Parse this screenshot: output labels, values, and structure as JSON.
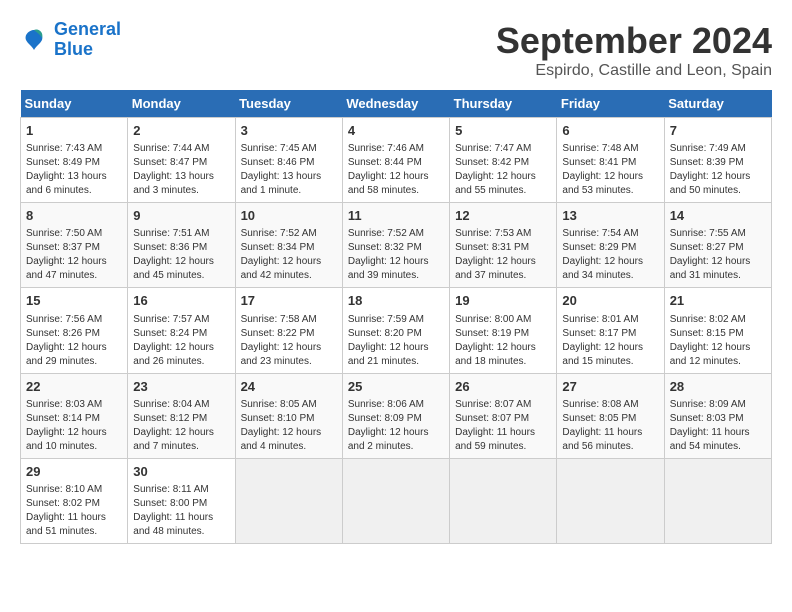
{
  "header": {
    "logo_line1": "General",
    "logo_line2": "Blue",
    "main_title": "September 2024",
    "subtitle": "Espirdo, Castille and Leon, Spain"
  },
  "calendar": {
    "days_of_week": [
      "Sunday",
      "Monday",
      "Tuesday",
      "Wednesday",
      "Thursday",
      "Friday",
      "Saturday"
    ],
    "weeks": [
      [
        {
          "day": "",
          "empty": true
        },
        {
          "day": "",
          "empty": true
        },
        {
          "day": "",
          "empty": true
        },
        {
          "day": "",
          "empty": true
        },
        {
          "day": "",
          "empty": true
        },
        {
          "day": "",
          "empty": true
        },
        {
          "day": "",
          "empty": true
        }
      ],
      [
        {
          "day": "1",
          "sunrise": "7:43 AM",
          "sunset": "8:49 PM",
          "daylight": "13 hours and 6 minutes."
        },
        {
          "day": "2",
          "sunrise": "7:44 AM",
          "sunset": "8:47 PM",
          "daylight": "13 hours and 3 minutes."
        },
        {
          "day": "3",
          "sunrise": "7:45 AM",
          "sunset": "8:46 PM",
          "daylight": "13 hours and 1 minute."
        },
        {
          "day": "4",
          "sunrise": "7:46 AM",
          "sunset": "8:44 PM",
          "daylight": "12 hours and 58 minutes."
        },
        {
          "day": "5",
          "sunrise": "7:47 AM",
          "sunset": "8:42 PM",
          "daylight": "12 hours and 55 minutes."
        },
        {
          "day": "6",
          "sunrise": "7:48 AM",
          "sunset": "8:41 PM",
          "daylight": "12 hours and 53 minutes."
        },
        {
          "day": "7",
          "sunrise": "7:49 AM",
          "sunset": "8:39 PM",
          "daylight": "12 hours and 50 minutes."
        }
      ],
      [
        {
          "day": "8",
          "sunrise": "7:50 AM",
          "sunset": "8:37 PM",
          "daylight": "12 hours and 47 minutes."
        },
        {
          "day": "9",
          "sunrise": "7:51 AM",
          "sunset": "8:36 PM",
          "daylight": "12 hours and 45 minutes."
        },
        {
          "day": "10",
          "sunrise": "7:52 AM",
          "sunset": "8:34 PM",
          "daylight": "12 hours and 42 minutes."
        },
        {
          "day": "11",
          "sunrise": "7:52 AM",
          "sunset": "8:32 PM",
          "daylight": "12 hours and 39 minutes."
        },
        {
          "day": "12",
          "sunrise": "7:53 AM",
          "sunset": "8:31 PM",
          "daylight": "12 hours and 37 minutes."
        },
        {
          "day": "13",
          "sunrise": "7:54 AM",
          "sunset": "8:29 PM",
          "daylight": "12 hours and 34 minutes."
        },
        {
          "day": "14",
          "sunrise": "7:55 AM",
          "sunset": "8:27 PM",
          "daylight": "12 hours and 31 minutes."
        }
      ],
      [
        {
          "day": "15",
          "sunrise": "7:56 AM",
          "sunset": "8:26 PM",
          "daylight": "12 hours and 29 minutes."
        },
        {
          "day": "16",
          "sunrise": "7:57 AM",
          "sunset": "8:24 PM",
          "daylight": "12 hours and 26 minutes."
        },
        {
          "day": "17",
          "sunrise": "7:58 AM",
          "sunset": "8:22 PM",
          "daylight": "12 hours and 23 minutes."
        },
        {
          "day": "18",
          "sunrise": "7:59 AM",
          "sunset": "8:20 PM",
          "daylight": "12 hours and 21 minutes."
        },
        {
          "day": "19",
          "sunrise": "8:00 AM",
          "sunset": "8:19 PM",
          "daylight": "12 hours and 18 minutes."
        },
        {
          "day": "20",
          "sunrise": "8:01 AM",
          "sunset": "8:17 PM",
          "daylight": "12 hours and 15 minutes."
        },
        {
          "day": "21",
          "sunrise": "8:02 AM",
          "sunset": "8:15 PM",
          "daylight": "12 hours and 12 minutes."
        }
      ],
      [
        {
          "day": "22",
          "sunrise": "8:03 AM",
          "sunset": "8:14 PM",
          "daylight": "12 hours and 10 minutes."
        },
        {
          "day": "23",
          "sunrise": "8:04 AM",
          "sunset": "8:12 PM",
          "daylight": "12 hours and 7 minutes."
        },
        {
          "day": "24",
          "sunrise": "8:05 AM",
          "sunset": "8:10 PM",
          "daylight": "12 hours and 4 minutes."
        },
        {
          "day": "25",
          "sunrise": "8:06 AM",
          "sunset": "8:09 PM",
          "daylight": "12 hours and 2 minutes."
        },
        {
          "day": "26",
          "sunrise": "8:07 AM",
          "sunset": "8:07 PM",
          "daylight": "11 hours and 59 minutes."
        },
        {
          "day": "27",
          "sunrise": "8:08 AM",
          "sunset": "8:05 PM",
          "daylight": "11 hours and 56 minutes."
        },
        {
          "day": "28",
          "sunrise": "8:09 AM",
          "sunset": "8:03 PM",
          "daylight": "11 hours and 54 minutes."
        }
      ],
      [
        {
          "day": "29",
          "sunrise": "8:10 AM",
          "sunset": "8:02 PM",
          "daylight": "11 hours and 51 minutes."
        },
        {
          "day": "30",
          "sunrise": "8:11 AM",
          "sunset": "8:00 PM",
          "daylight": "11 hours and 48 minutes."
        },
        {
          "day": "",
          "empty": true
        },
        {
          "day": "",
          "empty": true
        },
        {
          "day": "",
          "empty": true
        },
        {
          "day": "",
          "empty": true
        },
        {
          "day": "",
          "empty": true
        }
      ]
    ]
  }
}
